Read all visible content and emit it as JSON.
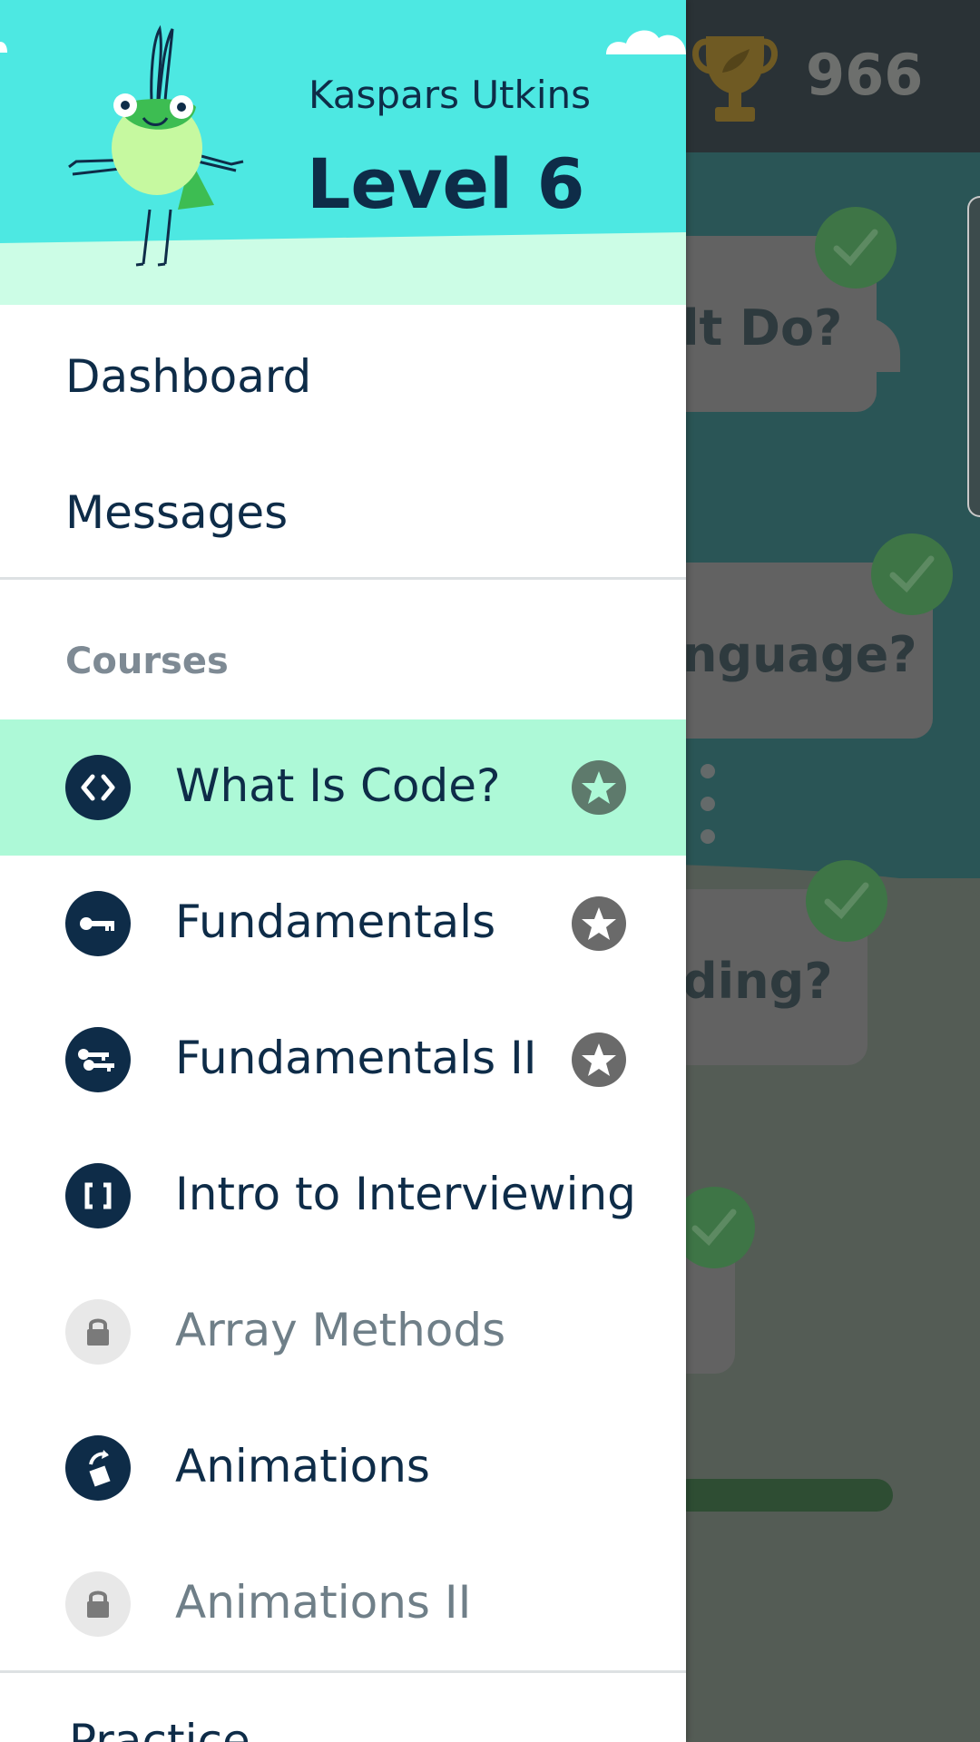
{
  "background": {
    "score": "966",
    "cards": [
      "lt Do?",
      "nguage?",
      "ding?"
    ]
  },
  "drawer": {
    "user_name": "Kaspars Utkins",
    "level": "Level 6",
    "nav": {
      "dashboard": "Dashboard",
      "messages": "Messages"
    },
    "courses_title": "Courses",
    "courses": [
      {
        "label": "What Is Code?",
        "icon": "code-brackets-icon",
        "locked": false,
        "star": true,
        "active": true
      },
      {
        "label": "Fundamentals",
        "icon": "key-icon",
        "locked": false,
        "star": true,
        "active": false
      },
      {
        "label": "Fundamentals II",
        "icon": "keys-icon",
        "locked": false,
        "star": true,
        "active": false
      },
      {
        "label": "Intro to Interviewing",
        "icon": "square-brackets-icon",
        "locked": false,
        "star": false,
        "active": false
      },
      {
        "label": "Array Methods",
        "icon": "lock-icon",
        "locked": true,
        "star": false,
        "active": false
      },
      {
        "label": "Animations",
        "icon": "rotate-icon",
        "locked": false,
        "star": false,
        "active": false
      },
      {
        "label": "Animations II",
        "icon": "lock-icon",
        "locked": true,
        "star": false,
        "active": false
      }
    ],
    "practice": "Practice"
  },
  "colors": {
    "header_sky": "#4de8e2",
    "header_ground": "#ccfde6",
    "active_course": "#adf9d7",
    "text_dark": "#0e2c48"
  }
}
